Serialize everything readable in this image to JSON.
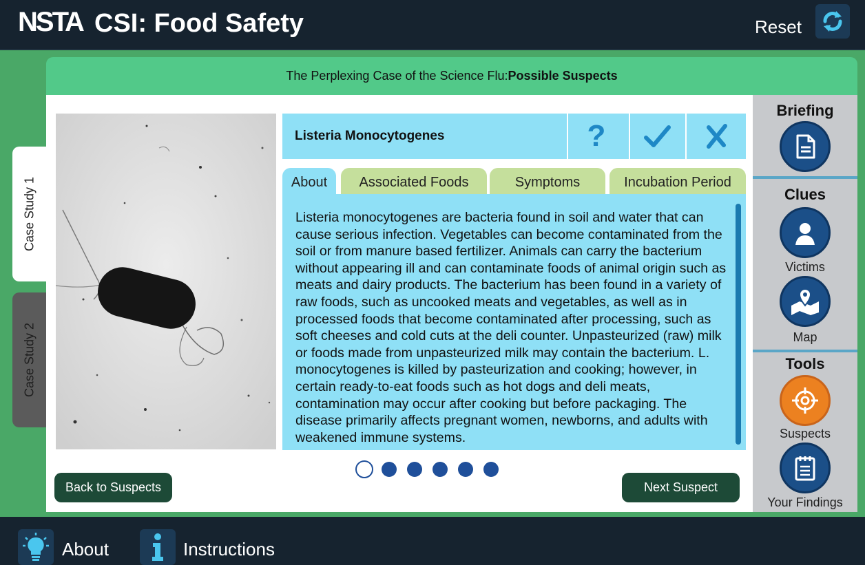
{
  "header": {
    "logo": "NSTA",
    "title": "CSI: Food Safety",
    "reset_label": "Reset"
  },
  "case": {
    "title_prefix": "The Perplexing Case of the Science Flu:",
    "title_section": "Possible Suspects"
  },
  "case_tabs": [
    {
      "label": "Case Study 1",
      "active": true
    },
    {
      "label": "Case Study 2",
      "active": false
    }
  ],
  "suspect": {
    "name": "Listeria Monocytogenes",
    "help_symbol": "?"
  },
  "info_tabs": [
    {
      "label": "About",
      "active": true
    },
    {
      "label": "Associated Foods",
      "active": false
    },
    {
      "label": "Symptoms",
      "active": false
    },
    {
      "label": "Incubation Period",
      "active": false
    }
  ],
  "about_text": "Listeria monocytogenes are bacteria found in soil and water that can cause serious infection. Vegetables can become contaminated from the soil or from manure based fertilizer. Animals can carry the bacterium without appearing ill and can contaminate foods of animal origin such as meats and dairy products. The bacterium has been found in a variety of raw foods, such as uncooked meats and vegetables, as well as in processed foods that become contaminated after processing, such as soft cheeses and cold cuts at the deli counter. Unpasteurized (raw) milk or foods made from unpasteurized milk may contain the bacterium. L. monocytogenes is killed by pasteurization and cooking; however, in certain ready-to-eat foods such as hot dogs and deli meats, contamination may occur after cooking but before packaging. The disease primarily affects pregnant women, newborns, and adults with weakened immune systems.",
  "pagination": {
    "current": 1,
    "total": 6
  },
  "nav": {
    "back_label": "Back to Suspects",
    "next_label": "Next Suspect"
  },
  "sidebar": {
    "briefing_title": "Briefing",
    "clues_title": "Clues",
    "tools_title": "Tools",
    "victims_label": "Victims",
    "map_label": "Map",
    "suspects_label": "Suspects",
    "findings_label": "Your Findings"
  },
  "footer": {
    "about_label": "About",
    "instructions_label": "Instructions"
  },
  "colors": {
    "accent_blue": "#8fe0f6",
    "tab_green": "#c5df9c",
    "header_green": "#52c989",
    "nav_dark": "#16232f",
    "button_dark_green": "#1d4a37"
  }
}
